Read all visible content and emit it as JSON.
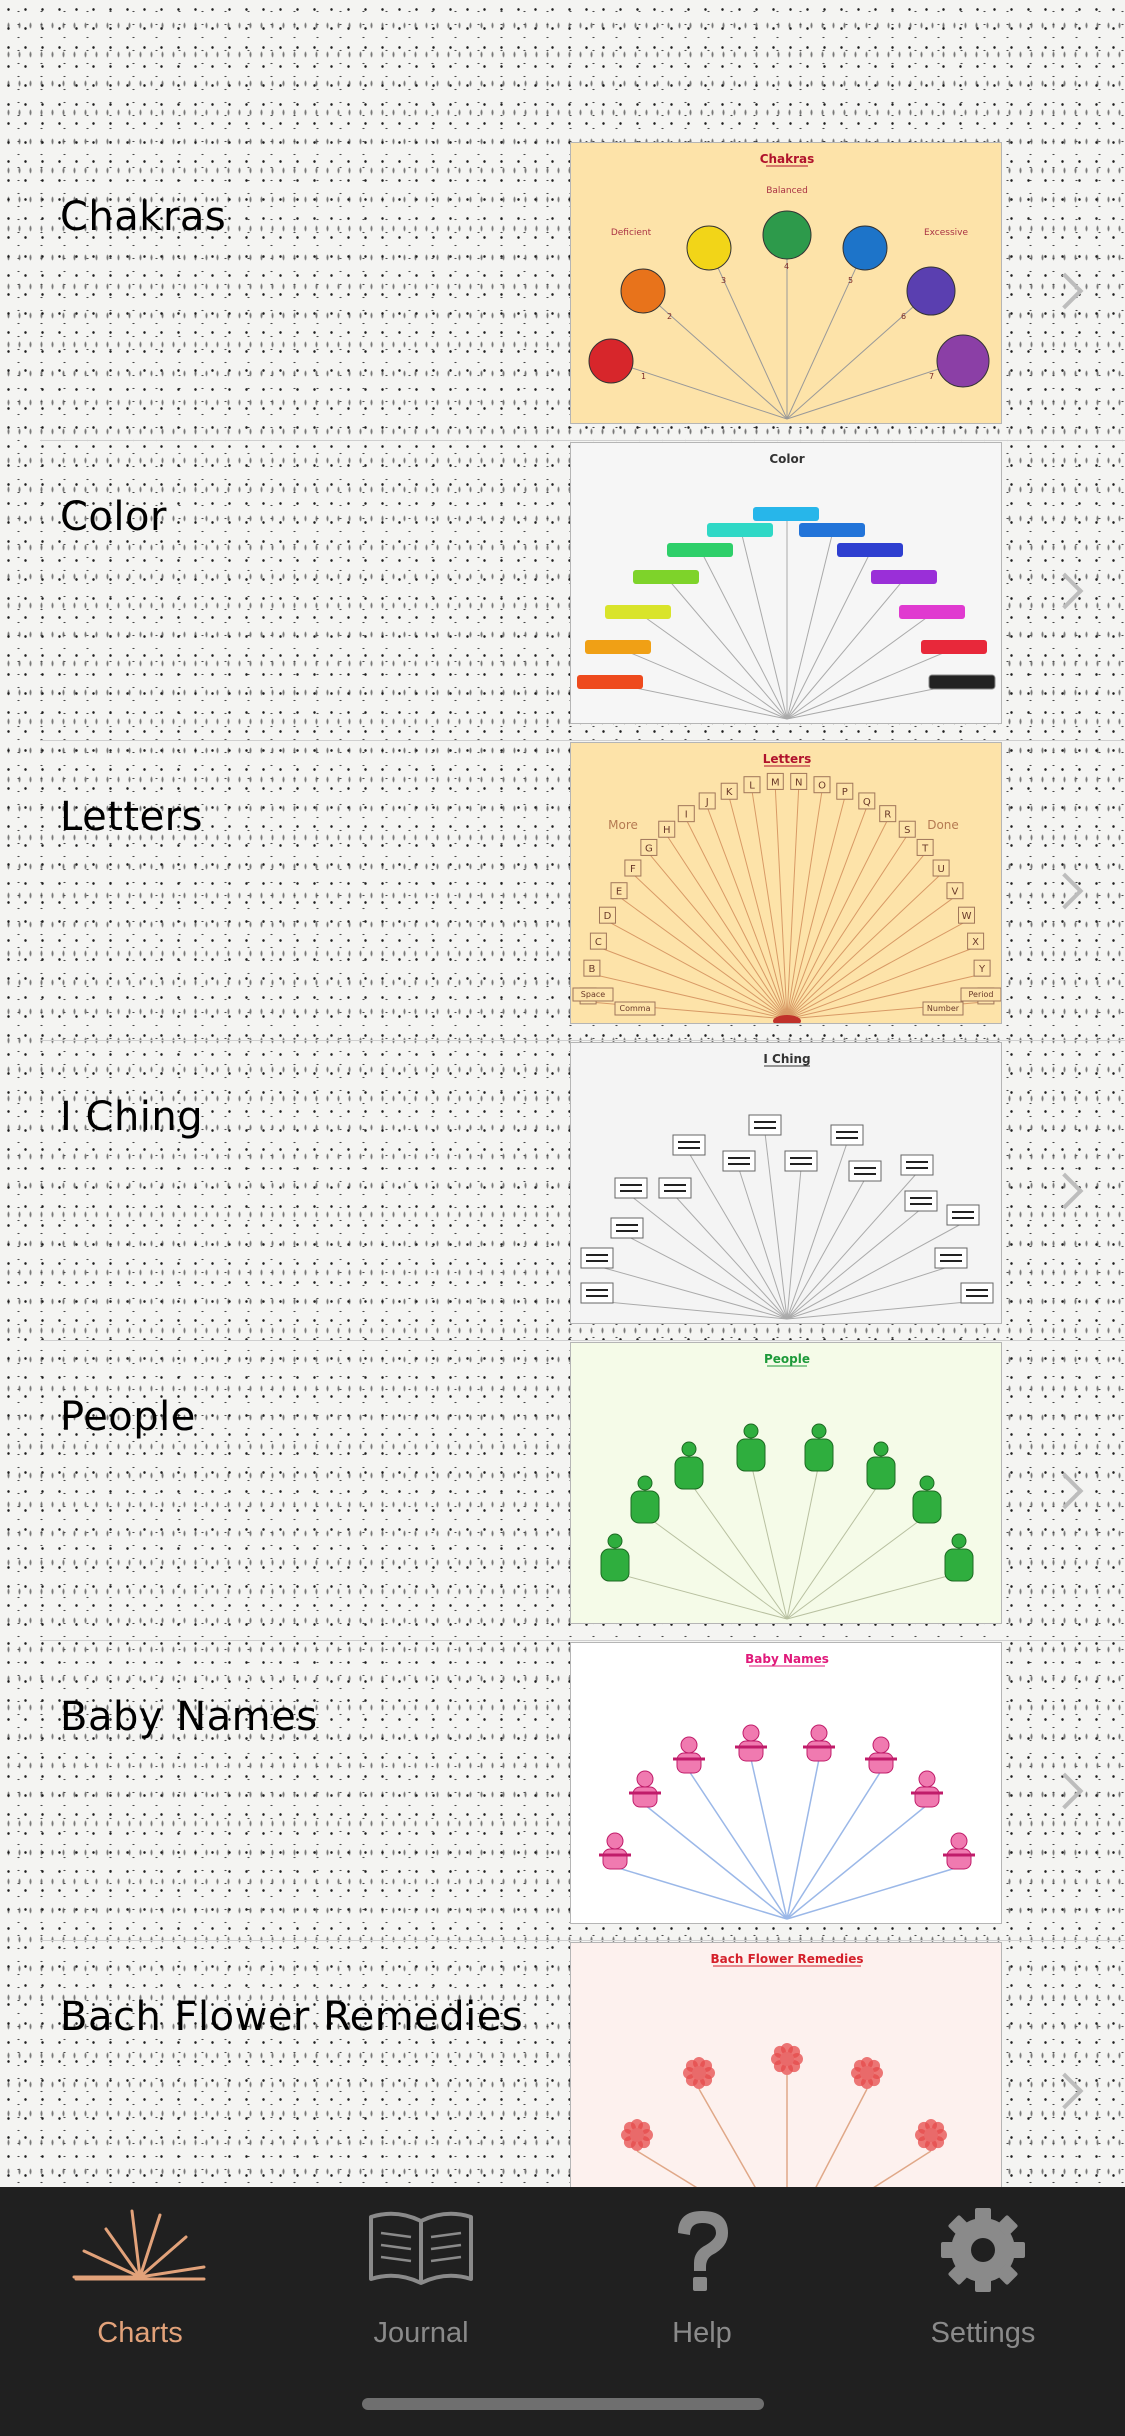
{
  "rows": [
    {
      "label": "Chakras",
      "thumb": {
        "title": "Chakras",
        "left": "Deficient",
        "mid": "Balanced",
        "right": "Excessive",
        "nums": [
          "1",
          "2",
          "3",
          "4",
          "5",
          "6",
          "7"
        ]
      }
    },
    {
      "label": "Color",
      "thumb": {
        "title": "Color"
      }
    },
    {
      "label": "Letters",
      "thumb": {
        "title": "Letters",
        "left": "More",
        "right": "Done",
        "letters": [
          "A",
          "B",
          "C",
          "D",
          "E",
          "F",
          "G",
          "H",
          "I",
          "J",
          "K",
          "L",
          "M",
          "N",
          "O",
          "P",
          "Q",
          "R",
          "S",
          "T",
          "U",
          "V",
          "W",
          "X",
          "Y",
          "Z"
        ],
        "bottom": [
          "Space",
          "Comma",
          "Number",
          "Period"
        ]
      }
    },
    {
      "label": "I Ching",
      "thumb": {
        "title": "I Ching"
      }
    },
    {
      "label": "People",
      "thumb": {
        "title": "People"
      }
    },
    {
      "label": "Baby Names",
      "thumb": {
        "title": "Baby Names"
      }
    },
    {
      "label": "Bach Flower Remedies",
      "thumb": {
        "title": "Bach Flower Remedies"
      }
    }
  ],
  "tabs": [
    {
      "label": "Charts",
      "icon": "charts-icon",
      "active": true
    },
    {
      "label": "Journal",
      "icon": "book-icon",
      "active": false
    },
    {
      "label": "Help",
      "icon": "question-icon",
      "active": false
    },
    {
      "label": "Settings",
      "icon": "gear-icon",
      "active": false
    }
  ],
  "colors": {
    "accent": "#e2a27a",
    "tab_inactive": "#8a8a8a",
    "tabbar_bg": "#202020"
  }
}
